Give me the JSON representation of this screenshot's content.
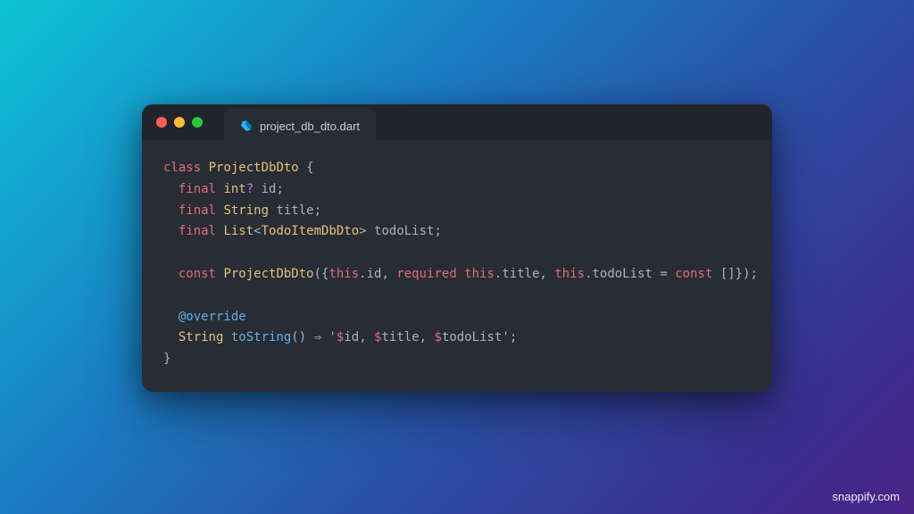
{
  "window": {
    "tab": {
      "filename": "project_db_dto.dart",
      "icon_name": "dart-file-icon"
    }
  },
  "code": {
    "l1": {
      "kw_class": "class",
      "type": "ProjectDbDto",
      "open": " {"
    },
    "l2": {
      "kw_final": "final",
      "type": "int",
      "nullable": "?",
      "name": " id;"
    },
    "l3": {
      "kw_final": "final",
      "type": "String",
      "name": " title;"
    },
    "l4": {
      "kw_final": "final",
      "type_outer": "List",
      "lt": "<",
      "type_inner": "TodoItemDbDto",
      "gt": ">",
      "name": " todoList;"
    },
    "l5": {
      "kw_const": "const",
      "ctor": "ProjectDbDto",
      "open": "({",
      "this1": "this",
      "dot_id": ".id, ",
      "kw_required": "required",
      "sp": " ",
      "this2": "this",
      "dot_title": ".title, ",
      "this3": "this",
      "dot_todo": ".todoList = ",
      "kw_const2": "const",
      "empty": " []});"
    },
    "l6": {
      "at": "@",
      "override": "override"
    },
    "l7": {
      "type": "String",
      "fn": "toString",
      "parens": "()",
      "arrow": " ⇒ ",
      "str_open": "'",
      "interp1a": "$",
      "interp1b": "id",
      "sep1": ", ",
      "interp2a": "$",
      "interp2b": "title",
      "sep2": ", ",
      "interp3a": "$",
      "interp3b": "todoList",
      "str_close": "'",
      "semi": ";"
    },
    "l8": {
      "close": "}"
    }
  },
  "watermark": "snappify.com"
}
